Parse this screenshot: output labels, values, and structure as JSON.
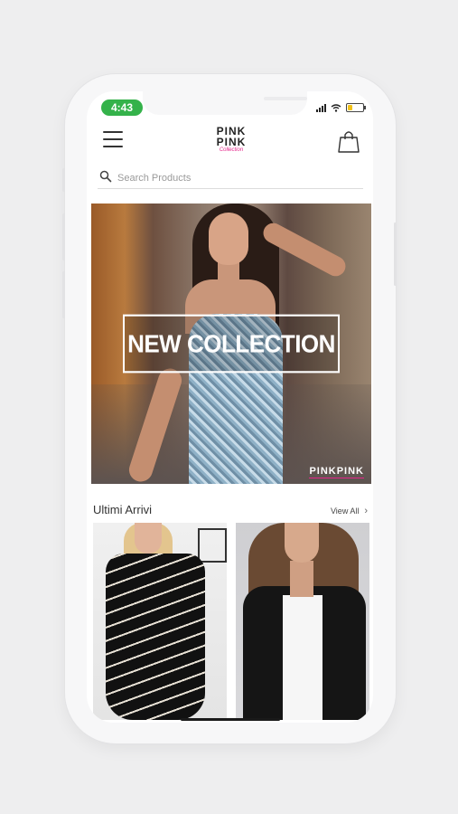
{
  "status_bar": {
    "time": "4:43"
  },
  "header": {
    "logo_text": "PINK PINK",
    "logo_sub": "Collection"
  },
  "search": {
    "placeholder": "Search Products",
    "value": ""
  },
  "hero": {
    "title": "NEW COLLECTION",
    "watermark": "PINKPINK"
  },
  "section": {
    "title": "Ultimi Arrivi",
    "view_all": "View All"
  },
  "colors": {
    "time_pill": "#34b24a",
    "brand_accent": "#e5258a",
    "battery": "#f1c21b"
  },
  "icons": [
    "menu-icon",
    "shopping-bag-icon",
    "search-icon",
    "chevron-right-icon",
    "wifi-icon",
    "signal-icon",
    "battery-icon"
  ]
}
